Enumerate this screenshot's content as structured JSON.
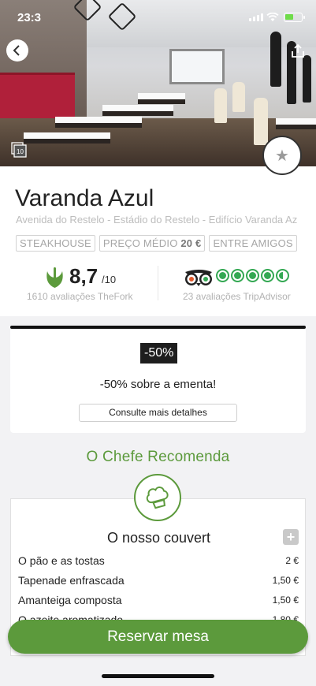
{
  "status_bar": {
    "time": "23:3"
  },
  "restaurant": {
    "name": "Varanda Azul",
    "address": "Avenida do Restelo - Estádio do Restelo - Edifício Varanda Az",
    "tags": {
      "cuisine": "STEAKHOUSE",
      "avg_price_label": "PREÇO MÉDIO",
      "avg_price_value": "20 €",
      "ambience": "ENTRE AMIGOS"
    }
  },
  "photo_count": "10",
  "ratings": {
    "thefork_score": "8,7",
    "thefork_max": "/10",
    "thefork_reviews": "1610 avaliações TheFork",
    "tripadvisor_bubbles": 4.5,
    "tripadvisor_reviews": "23 avaliações TripAdvisor"
  },
  "promo": {
    "badge": "-50%",
    "text": "-50% sobre a ementa!",
    "details_button": "Consulte mais detalhes"
  },
  "chef": {
    "title": "O Chefe Recomenda",
    "menu_title": "O nosso couvert",
    "expand_label": "+",
    "items": [
      {
        "name": "O pão e as tostas",
        "price": "2 €"
      },
      {
        "name": "Tapenade enfrascada",
        "price": "1,50 €"
      },
      {
        "name": "Amanteiga composta",
        "price": "1,50 €"
      },
      {
        "name": "O azeite aromatizado",
        "price": "1,80 €"
      }
    ]
  },
  "actions": {
    "reserve": "Reservar mesa"
  },
  "colors": {
    "accent_green": "#5c9a3c",
    "tripadvisor_green": "#34a853"
  }
}
